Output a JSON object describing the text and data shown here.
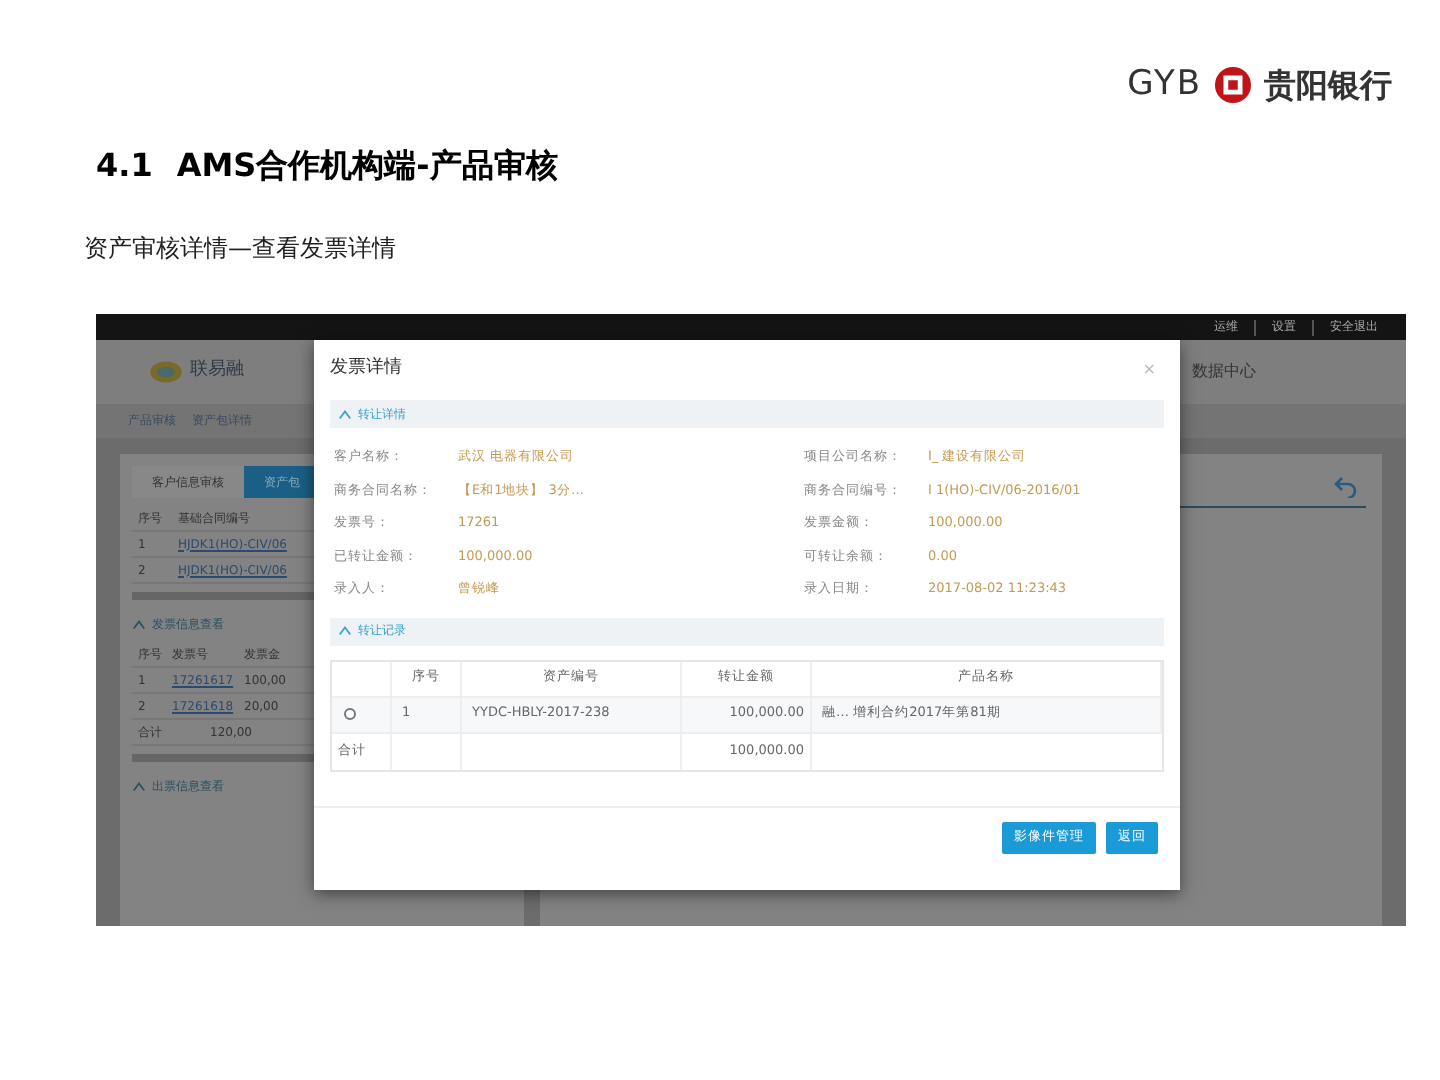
{
  "brand": {
    "letters": "GYB",
    "name": "贵阳银行"
  },
  "title": {
    "number": "4.1",
    "text": "AMS合作机构端-产品审核"
  },
  "subtitle": "资产审核详情—查看发票详情",
  "app": {
    "top_links": [
      "运维",
      "设置",
      "安全退出"
    ],
    "logo_name": "联易融",
    "header_item": "数据中心",
    "breadcrumbs": [
      "产品审核",
      "资产包详情"
    ],
    "tabs": [
      {
        "label": "客户信息审核",
        "selected": false
      },
      {
        "label": "资产包",
        "selected": true
      }
    ],
    "contract_table": {
      "columns": [
        "序号",
        "基础合同编号"
      ],
      "rows": [
        [
          "1",
          "HJDK1(HO)-CIV/06"
        ],
        [
          "2",
          "HJDK1(HO)-CIV/06"
        ]
      ]
    },
    "invoice_section": "发票信息查看",
    "invoice_table": {
      "columns": [
        "序号",
        "发票号",
        "发票金"
      ],
      "rows": [
        [
          "1",
          "17261617",
          "100,00"
        ],
        [
          "2",
          "17261618",
          "20,00"
        ]
      ],
      "total": {
        "label": "合计",
        "amount": "120,00"
      }
    },
    "last_section": "出票信息查看"
  },
  "dialog": {
    "title": "发票详情",
    "close": "×",
    "detail_section": "转让详情",
    "fields": [
      {
        "label": "客户名称：",
        "value": "武汉     电器有限公司"
      },
      {
        "label": "项目公司名称：",
        "value": "I_      建设有限公司"
      },
      {
        "label": "商务合同名称：",
        "value": "【E和1地块】    3分…"
      },
      {
        "label": "商务合同编号：",
        "value": "I    1(HO)-CIV/06-2016/01"
      },
      {
        "label": "发票号：",
        "value": "17261"
      },
      {
        "label": "发票金额：",
        "value": "100,000.00"
      },
      {
        "label": "已转让金额：",
        "value": "100,000.00"
      },
      {
        "label": "可转让余额：",
        "value": "0.00"
      },
      {
        "label": "录入人：",
        "value": "曾锐峰"
      },
      {
        "label": "录入日期：",
        "value": "2017-08-02 11:23:43"
      }
    ],
    "record_section": "转让记录",
    "records": {
      "columns": [
        "序号",
        "资产编号",
        "转让金额",
        "产品名称"
      ],
      "rows": [
        {
          "selected": false,
          "cells": [
            "1",
            "YYDC-HBLY-2017-238",
            "100,000.00",
            "融…     增利合约2017年第81期"
          ]
        }
      ],
      "total": {
        "label": "合计",
        "amount": "100,000.00"
      }
    },
    "buttons": [
      "影像件管理",
      "返回"
    ]
  }
}
